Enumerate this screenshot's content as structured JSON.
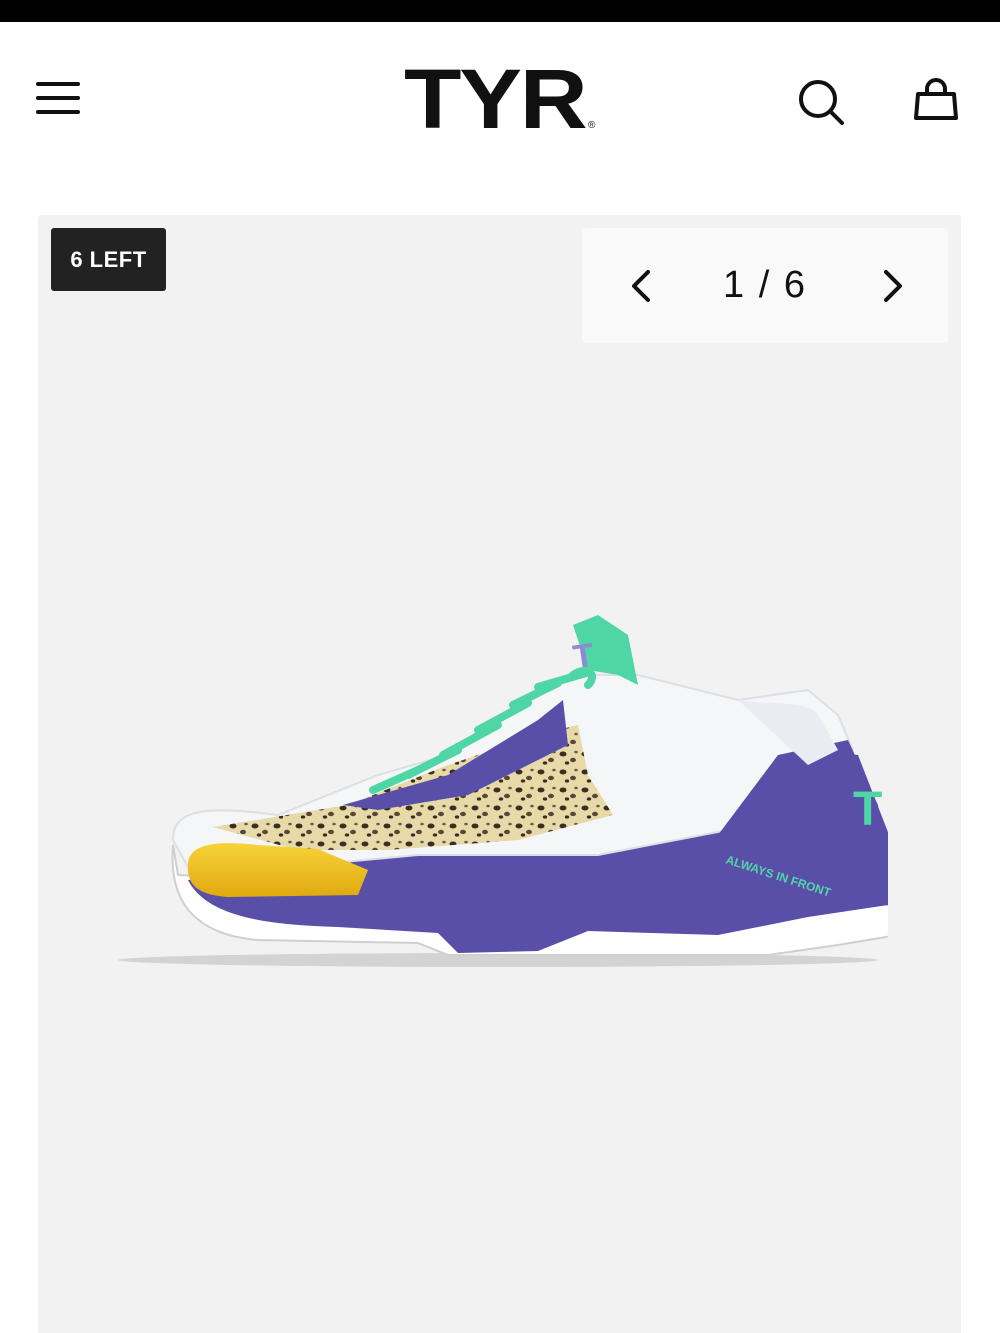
{
  "header": {
    "brand": "TYR",
    "brand_mark": "®",
    "menu_icon": "hamburger-menu-icon",
    "search_icon": "search-icon",
    "cart_icon": "shopping-bag-icon"
  },
  "gallery": {
    "stock_badge": "6 LEFT",
    "pager": {
      "current_label": "1 / 6",
      "prev_icon": "chevron-left-icon",
      "next_icon": "chevron-right-icon"
    },
    "image": {
      "description_label": "",
      "print_text": "ALWAYS IN FRONT",
      "colors": {
        "upper": "#f4f6f8",
        "sole": "#5a4fa8",
        "accent_mint": "#4fd6a6",
        "toe_yellow": "#f2c21e"
      }
    }
  },
  "colors": {
    "background": "#ffffff",
    "gallery_bg": "#f2f2f2",
    "badge_bg": "#222222",
    "text": "#111111"
  }
}
